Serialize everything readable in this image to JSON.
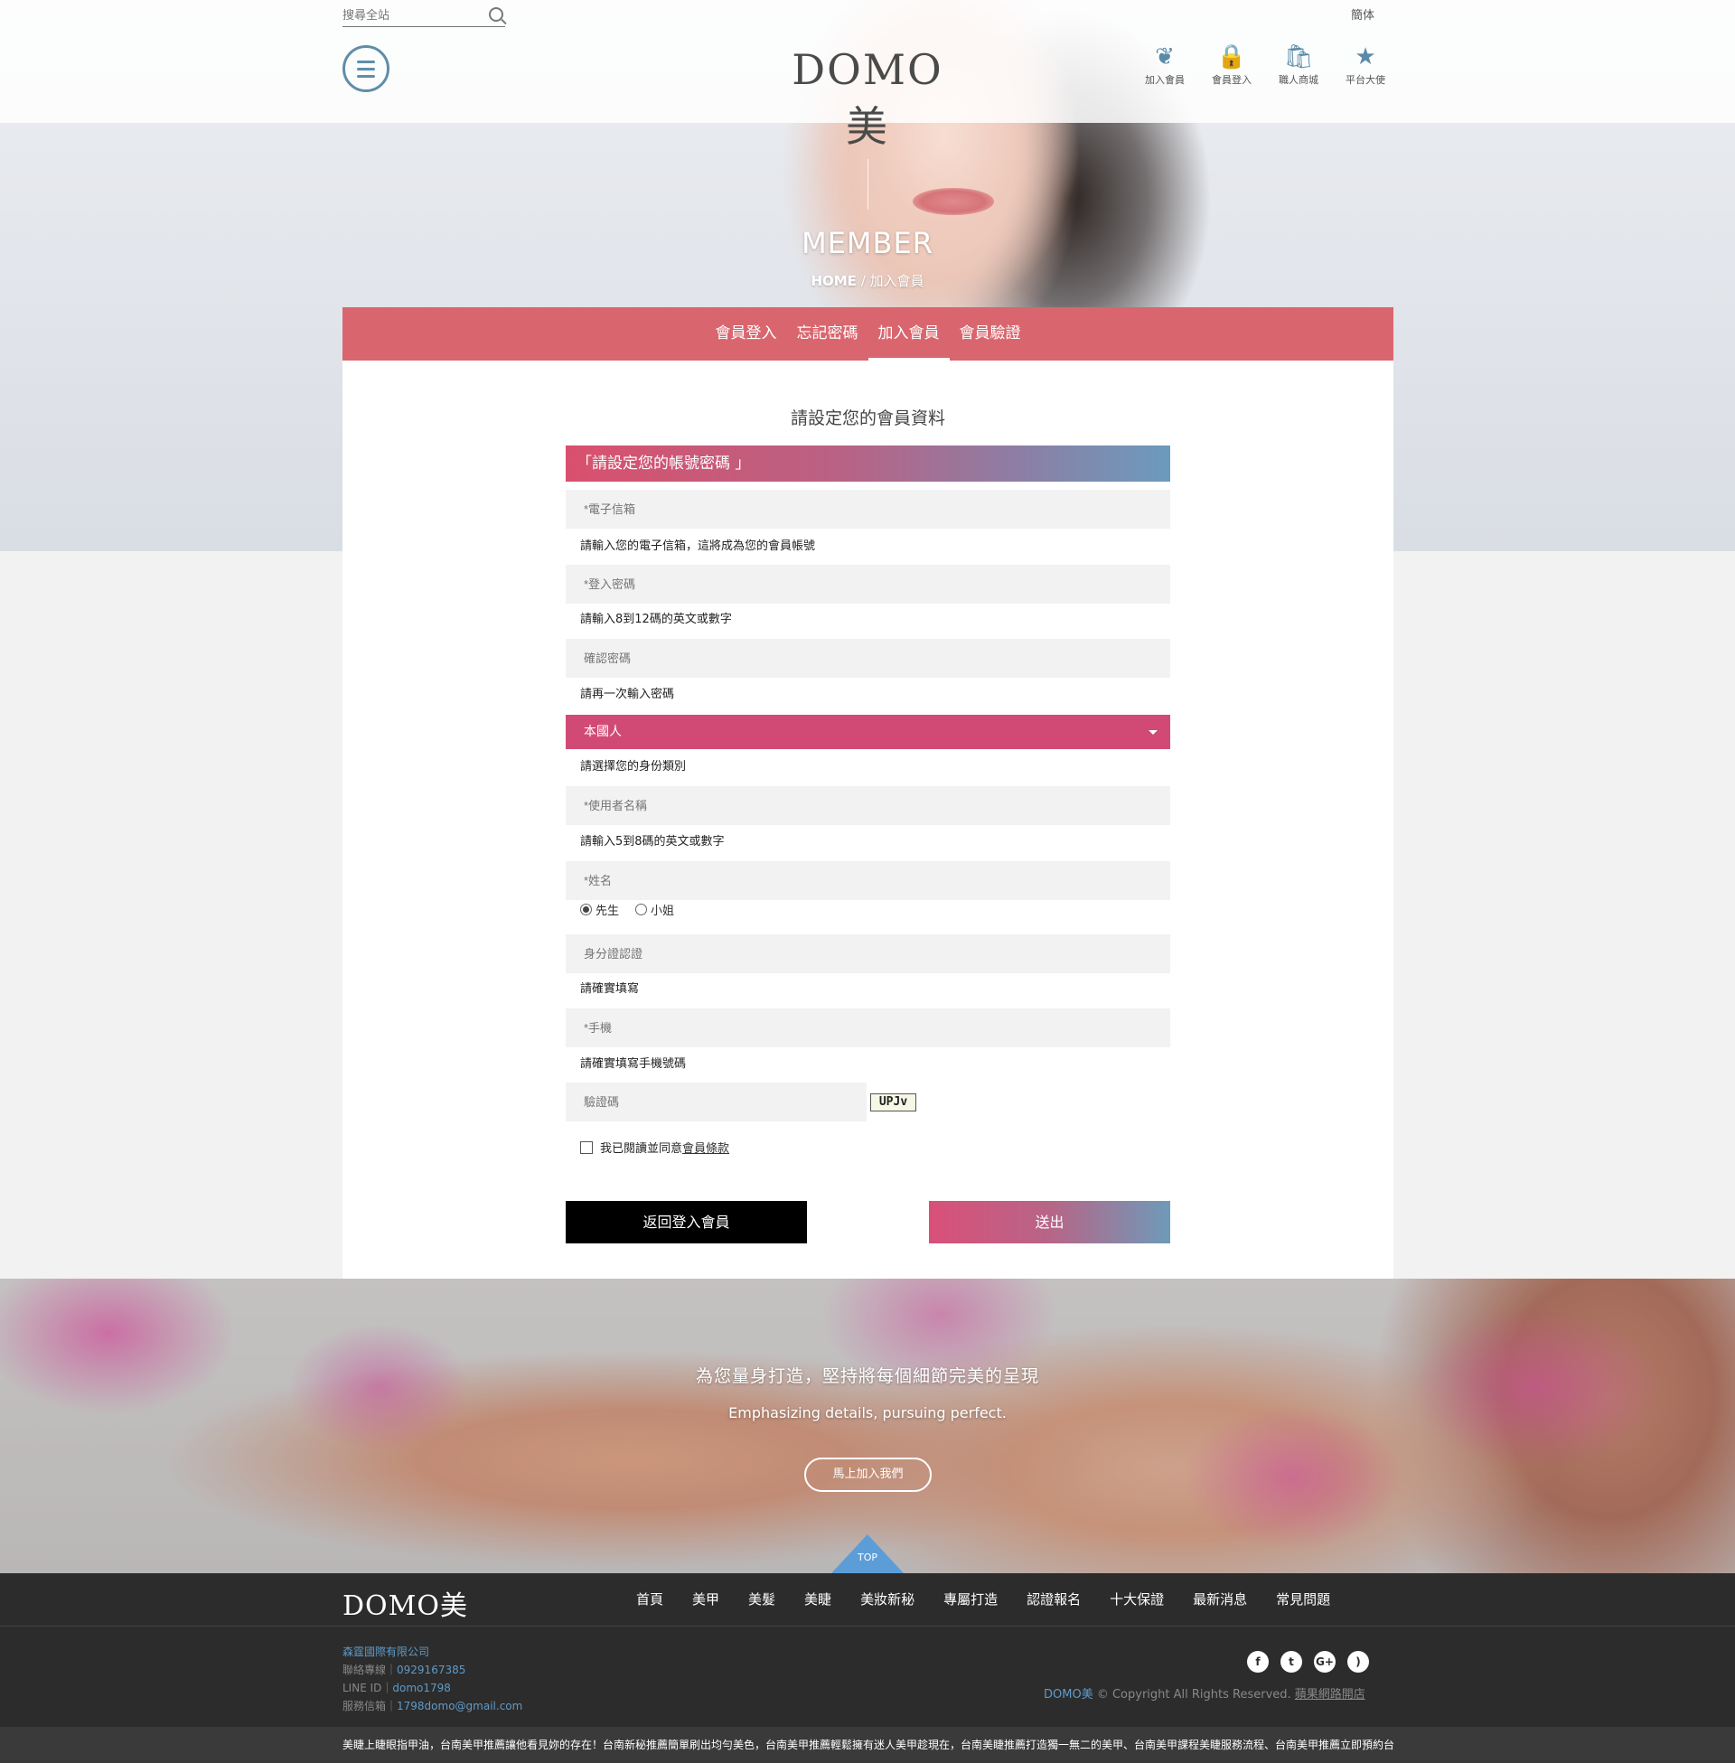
{
  "header": {
    "search_placeholder": "搜尋全站",
    "language": "簡体",
    "logo": "DOMO美",
    "icons": [
      {
        "name": "join-member-icon",
        "glyph": "❦",
        "label": "加入會員"
      },
      {
        "name": "member-login-icon",
        "glyph": "🔒",
        "label": "會員登入"
      },
      {
        "name": "shop-icon",
        "glyph": "🛍",
        "label": "職人商城"
      },
      {
        "name": "ambassador-icon",
        "glyph": "★",
        "label": "平台大使"
      }
    ]
  },
  "hero": {
    "title": "MEMBER",
    "crumb_home": "HOME",
    "crumb_sep": " / ",
    "crumb_current": "加入會員"
  },
  "tabs": [
    {
      "label": "會員登入",
      "active": false
    },
    {
      "label": "忘記密碼",
      "active": false
    },
    {
      "label": "加入會員",
      "active": true
    },
    {
      "label": "會員驗證",
      "active": false
    }
  ],
  "form": {
    "title": "請設定您的會員資料",
    "section": "「請設定您的帳號密碼 」",
    "email_placeholder": "*電子信箱",
    "email_hint": "請輸入您的電子信箱，這將成為您的會員帳號",
    "password_placeholder": "*登入密碼",
    "password_hint": "請輸入8到12碼的英文或數字",
    "confirm_placeholder": "確認密碼",
    "confirm_hint": "請再一次輸入密碼",
    "identity_value": "本國人",
    "identity_hint": "請選擇您的身份類別",
    "username_placeholder": "*使用者名稱",
    "username_hint": "請輸入5到8碼的英文或數字",
    "name_placeholder": "*姓名",
    "gender_mr": "先生",
    "gender_ms": "小姐",
    "gender_selected": "先生",
    "id_placeholder": "身分證認證",
    "id_hint": "請確實填寫",
    "mobile_placeholder": "*手機",
    "mobile_hint": "請確實填寫手機號碼",
    "captcha_placeholder": "驗證碼",
    "captcha_code": "UPJv",
    "agree_text": "我已閱讀並同意",
    "agree_link": "會員條款",
    "back_label": "返回登入會員",
    "submit_label": "送出"
  },
  "banner": {
    "cn": "為您量身打造，堅持將每個細節完美的呈現",
    "en": "Emphasizing details, pursuing perfect.",
    "button": "馬上加入我們",
    "top": "TOP"
  },
  "footer": {
    "logo": "DOMO美",
    "links": [
      "首頁",
      "美甲",
      "美髮",
      "美睫",
      "美妝新秘",
      "專屬打造",
      "認證報名",
      "十大保證",
      "最新消息",
      "常見問題"
    ],
    "company": "森霆國際有限公司",
    "phone_label": "聯絡專線｜",
    "phone": "0929167385",
    "line_label": "LINE ID｜",
    "line": "domo1798",
    "email_label": "服務信箱｜",
    "email": "1798domo@gmail.com",
    "social": [
      {
        "name": "facebook-icon",
        "glyph": "f"
      },
      {
        "name": "twitter-icon",
        "glyph": "t"
      },
      {
        "name": "google-plus-icon",
        "glyph": "G+"
      },
      {
        "name": "rss-icon",
        "glyph": ")"
      }
    ],
    "brand": "DOMO美",
    "copyright": " © Copyright All Rights Reserved. ",
    "made_by": "蘋果網路開店",
    "ticker": "美睫上睫眼指甲油，台南美甲推薦讓他看見妳的存在！台南新秘推薦簡單刷出均勻美色，台南美甲推薦輕鬆擁有迷人美甲趁現在，台南美睫推薦打造獨一無二的美甲、台南美甲課程美睫服務流程、台南美甲推薦立即預約台"
  },
  "colors": {
    "tab_bar": "#d9666e",
    "select": "#d14a75",
    "accent_blue": "#5f9ac7",
    "footer_bg": "#2c2c2c"
  }
}
